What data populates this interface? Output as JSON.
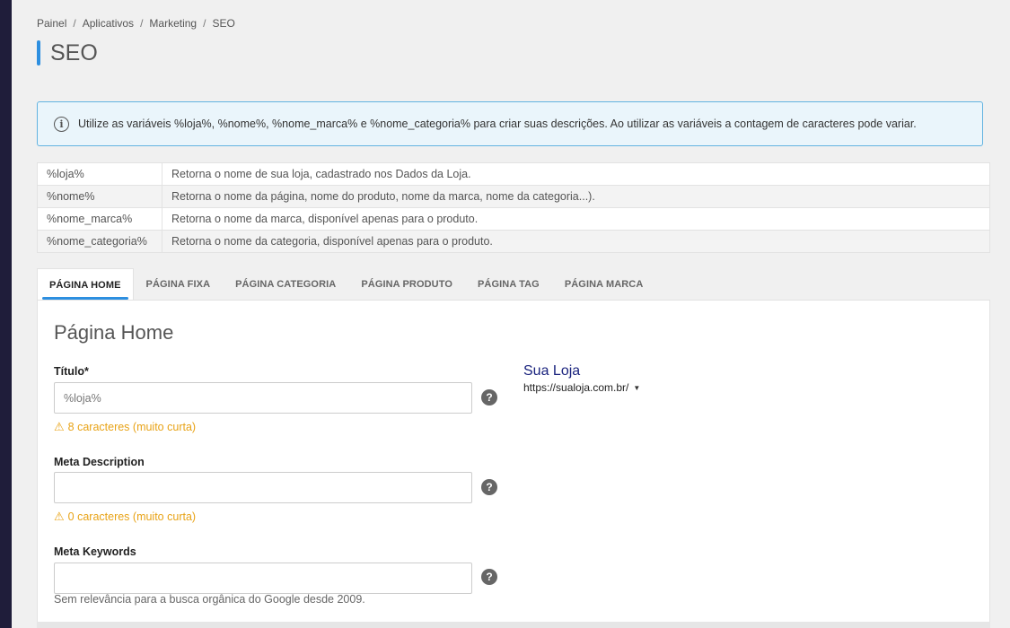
{
  "breadcrumb": [
    "Painel",
    "Aplicativos",
    "Marketing",
    "SEO"
  ],
  "breadcrumb_separator": "/",
  "page_title": "SEO",
  "alert": {
    "icon": "info-icon",
    "text": "Utilize as variáveis %loja%, %nome%, %nome_marca% e %nome_categoria% para criar suas descrições. Ao utilizar as variáveis a contagem de caracteres pode variar."
  },
  "variables": [
    {
      "name": "%loja%",
      "description": "Retorna o nome de sua loja, cadastrado nos Dados da Loja."
    },
    {
      "name": "%nome%",
      "description": "Retorna o nome da página, nome do produto, nome da marca, nome da categoria...)."
    },
    {
      "name": "%nome_marca%",
      "description": "Retorna o nome da marca, disponível apenas para o produto."
    },
    {
      "name": "%nome_categoria%",
      "description": "Retorna o nome da categoria, disponível apenas para o produto."
    }
  ],
  "tabs": [
    "PÁGINA HOME",
    "PÁGINA FIXA",
    "PÁGINA CATEGORIA",
    "PÁGINA PRODUTO",
    "PÁGINA TAG",
    "PÁGINA MARCA"
  ],
  "active_tab": "PÁGINA HOME",
  "panel": {
    "title": "Página Home",
    "title_field": {
      "label": "Título*",
      "placeholder": "%loja%",
      "value": "",
      "warning": "8 caracteres (muito curta)"
    },
    "meta_description": {
      "label": "Meta Description",
      "value": "",
      "warning": "0 caracteres (muito curta)"
    },
    "meta_keywords": {
      "label": "Meta Keywords",
      "value": "",
      "hint": "Sem relevância para a busca orgânica do Google desde 2009."
    },
    "help_symbol": "?",
    "warning_symbol": "⚠",
    "preview": {
      "title": "Sua Loja",
      "url": "https://sualoja.com.br/",
      "caret": "▼"
    }
  },
  "colors": {
    "accent": "#2d8fe0",
    "warning": "#e8a317",
    "sidebar": "#1f1d3a",
    "preview_title": "#1a237e"
  }
}
